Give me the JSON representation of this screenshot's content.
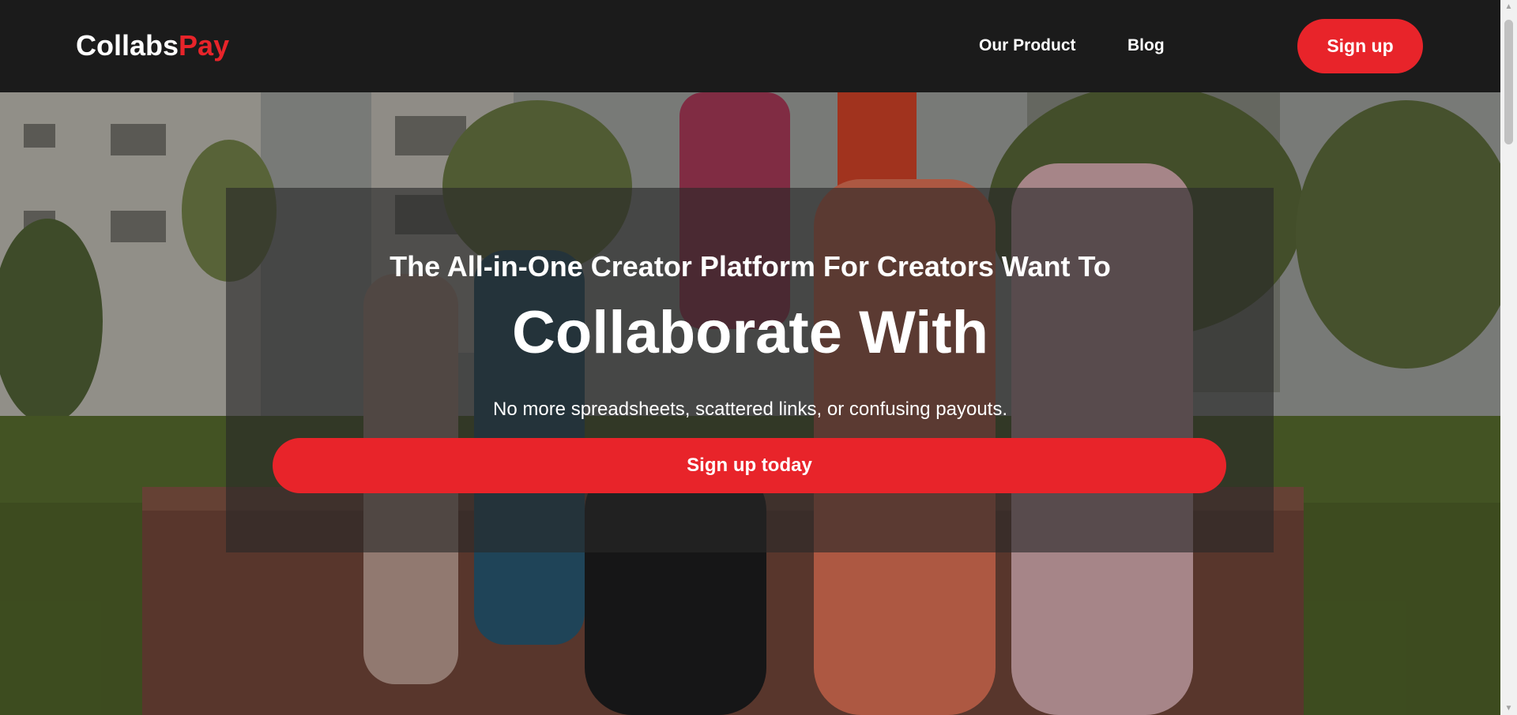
{
  "header": {
    "logo_part1": "Collabs",
    "logo_part2": "Pay",
    "nav": {
      "product_label": "Our Product",
      "blog_label": "Blog"
    },
    "signup_label": "Sign up"
  },
  "hero": {
    "kicker": "The All-in-One Creator Platform For Creators Want To",
    "title": "Collaborate With",
    "subtitle": "No more spreadsheets, scattered links, or confusing payouts.",
    "cta_label": "Sign up today"
  },
  "colors": {
    "brand_red": "#e8242a",
    "header_bg": "#1b1b1b",
    "text_light": "#ffffff"
  },
  "icons": {
    "scroll_up": "triangle-up-icon",
    "scroll_down": "triangle-down-icon"
  }
}
